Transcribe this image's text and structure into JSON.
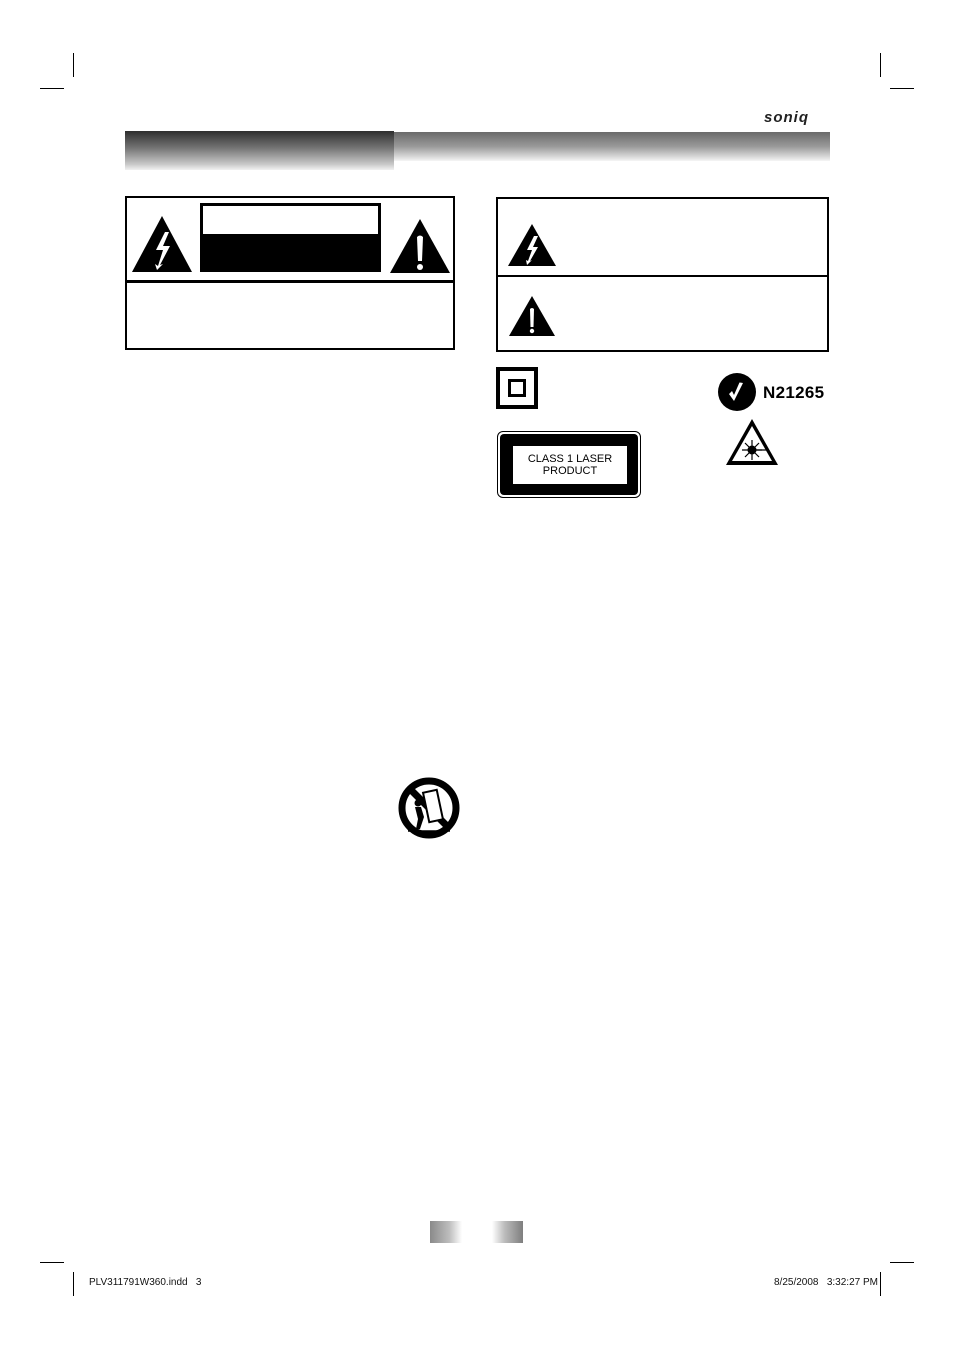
{
  "header": {
    "brand": "soniq"
  },
  "caution_panel": {
    "label_top_text": "",
    "label_bottom_text": "",
    "body_text": ""
  },
  "symbol_panel": {
    "rows": [
      {
        "icon": "lightning-warning-icon",
        "text": ""
      },
      {
        "icon": "exclamation-warning-icon",
        "text": ""
      }
    ]
  },
  "certifications": {
    "class2_icon": "double-square-icon",
    "laser_label_lines": [
      "CLASS 1 LASER",
      "PRODUCT"
    ],
    "ctick_code": "N21265",
    "laser_warning_icon": "laser-radiation-icon"
  },
  "cart_warning_icon": "cart-tipover-warning-icon",
  "page_number": "",
  "footer": {
    "file_name": "PLV311791W360.indd   3",
    "timestamp": "8/25/2008   3:32:27 PM"
  }
}
